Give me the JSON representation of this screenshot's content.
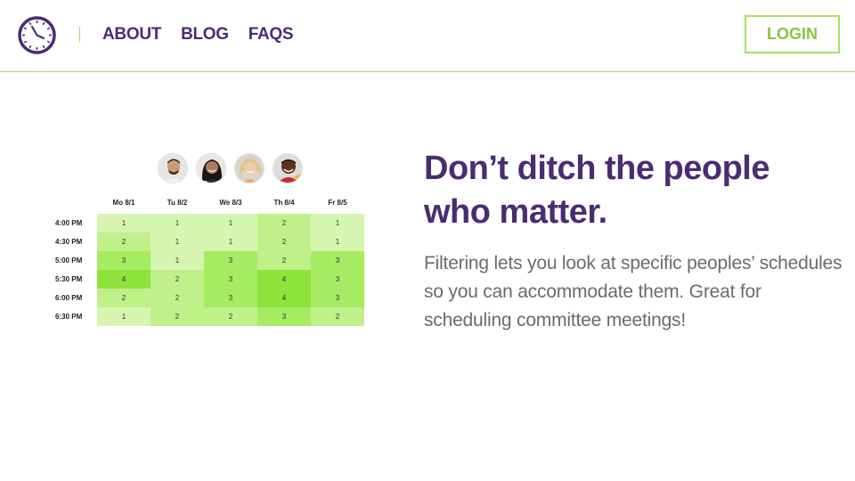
{
  "header": {
    "nav": [
      {
        "label": "ABOUT"
      },
      {
        "label": "BLOG"
      },
      {
        "label": "FAQS"
      }
    ],
    "login_label": "LOGIN",
    "logo_icon": "clock-icon"
  },
  "colors": {
    "brand_purple": "#4b2c72",
    "accent_green": "#a8e063",
    "login_text": "#8ac43f"
  },
  "avatars": [
    {
      "icon": "avatar-person-1"
    },
    {
      "icon": "avatar-person-2"
    },
    {
      "icon": "avatar-person-3"
    },
    {
      "icon": "avatar-person-4"
    }
  ],
  "schedule": {
    "days": [
      "Mo 8/1",
      "Tu 8/2",
      "We 8/3",
      "Th 8/4",
      "Fr 8/5"
    ],
    "rows": [
      {
        "time": "4:00 PM",
        "values": [
          1,
          1,
          1,
          2,
          1
        ]
      },
      {
        "time": "4:30 PM",
        "values": [
          2,
          1,
          1,
          2,
          1
        ]
      },
      {
        "time": "5:00 PM",
        "values": [
          3,
          1,
          3,
          2,
          3
        ]
      },
      {
        "time": "5:30 PM",
        "values": [
          4,
          2,
          3,
          4,
          3
        ]
      },
      {
        "time": "6:00 PM",
        "values": [
          2,
          2,
          3,
          4,
          3
        ]
      },
      {
        "time": "6:30 PM",
        "values": [
          1,
          2,
          2,
          3,
          2
        ]
      }
    ]
  },
  "hero": {
    "headline": "Don’t ditch the people who matter.",
    "body": "Filtering lets you look at specific peoples’ schedules so you can accommodate them. Great for scheduling committee meetings!"
  }
}
